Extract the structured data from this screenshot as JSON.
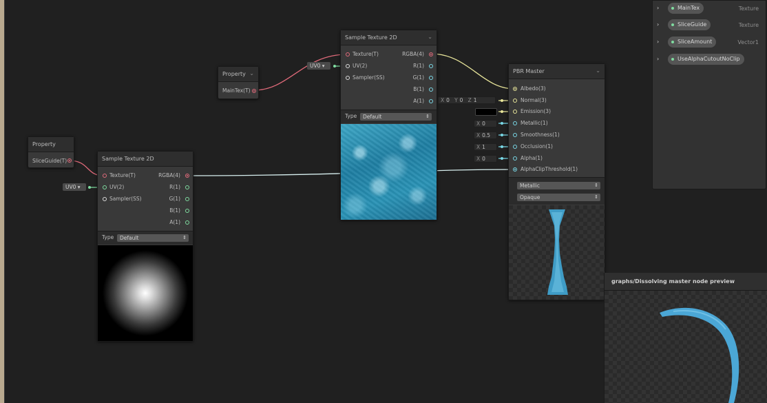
{
  "graph": {
    "property_node_1": {
      "title": "Property",
      "output_label": "MainTex(T)"
    },
    "property_node_2": {
      "title": "Property",
      "output_label": "SliceGuide(T)"
    },
    "uv_chip_1": {
      "label": "UV0"
    },
    "uv_chip_2": {
      "label": "UV0"
    },
    "sample_tex_top": {
      "title": "Sample Texture 2D",
      "inputs": [
        "Texture(T)",
        "UV(2)",
        "Sampler(SS)"
      ],
      "outputs": [
        "RGBA(4)",
        "R(1)",
        "G(1)",
        "B(1)",
        "A(1)"
      ],
      "type_label": "Type",
      "type_value": "Default"
    },
    "sample_tex_left": {
      "title": "Sample Texture 2D",
      "inputs": [
        "Texture(T)",
        "UV(2)",
        "Sampler(SS)"
      ],
      "outputs": [
        "RGBA(4)",
        "R(1)",
        "G(1)",
        "B(1)",
        "A(1)"
      ],
      "type_label": "Type",
      "type_value": "Default"
    },
    "pbr_master": {
      "title": "PBR Master",
      "inputs": [
        "Albedo(3)",
        "Normal(3)",
        "Emission(3)",
        "Metallic(1)",
        "Smoothness(1)",
        "Occlusion(1)",
        "Alpha(1)",
        "AlphaClipThreshold(1)"
      ],
      "workflow": "Metallic",
      "surface": "Opaque"
    },
    "normal_field": {
      "x_label": "X",
      "x": "0",
      "y_label": "Y",
      "y": "0",
      "z_label": "Z",
      "z": "1"
    },
    "metallic_field": {
      "axis": "X",
      "value": "0"
    },
    "smoothness_field": {
      "axis": "X",
      "value": "0.5"
    },
    "occlusion_field": {
      "axis": "X",
      "value": "1"
    },
    "alpha_field": {
      "axis": "X",
      "value": "0"
    }
  },
  "blackboard": {
    "properties": [
      {
        "name": "MainTex",
        "type": "Texture"
      },
      {
        "name": "SliceGuide",
        "type": "Texture"
      },
      {
        "name": "SliceAmount",
        "type": "Vector1"
      },
      {
        "name": "UseAlphaCutoutNoClip",
        "type": ""
      }
    ]
  },
  "master_preview": {
    "title": "graphs/Dissolving master node preview"
  },
  "colors": {
    "texture_port": "#e06a7a",
    "vector2_port": "#7fdca0",
    "vector3_port": "#e8e59a",
    "vector1_port": "#79d8e6",
    "background": "#202020"
  }
}
